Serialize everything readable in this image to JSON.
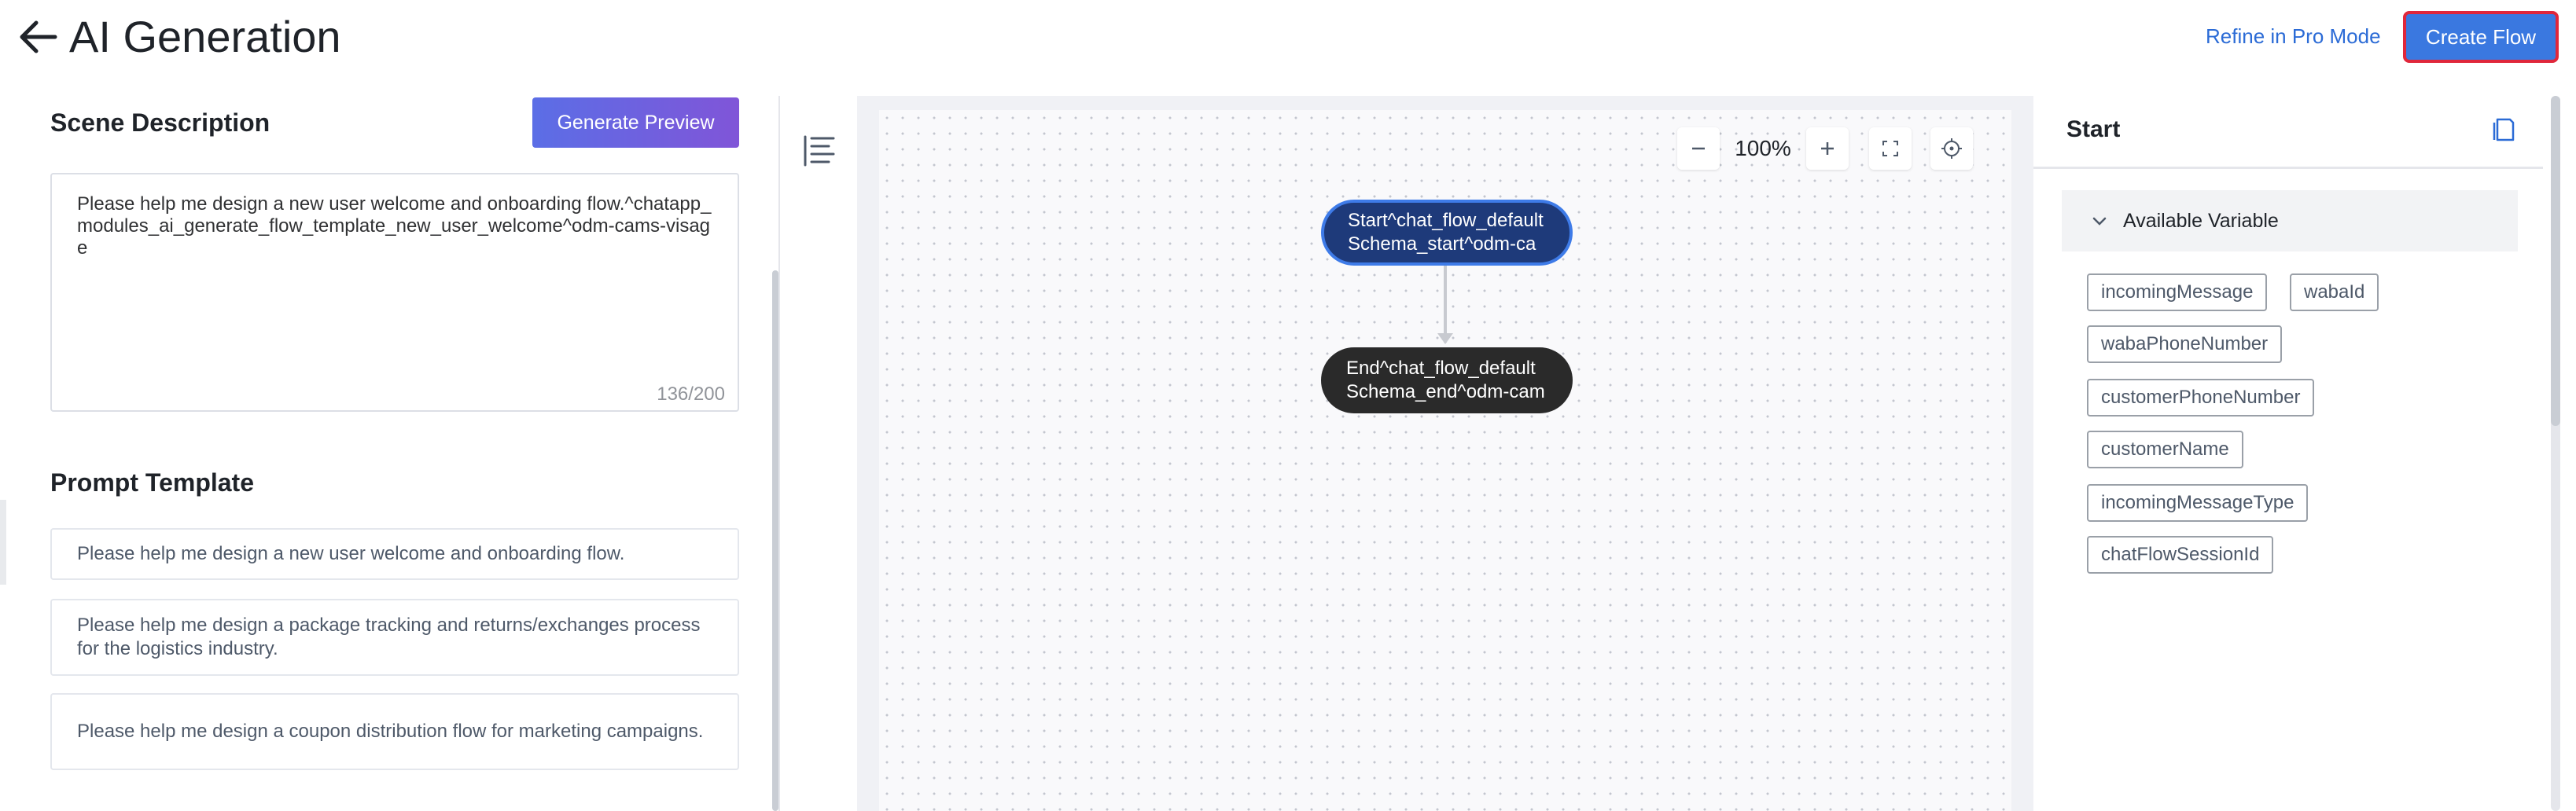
{
  "header": {
    "title": "AI Generation",
    "refine_label": "Refine in Pro Mode",
    "create_label": "Create Flow"
  },
  "scene": {
    "title": "Scene Description",
    "generate_label": "Generate Preview",
    "description": "Please help me design a new user welcome and onboarding flow.^chatapp_modules_ai_generate_flow_template_new_user_welcome^odm-cams-visage",
    "counter": "136/200"
  },
  "prompt": {
    "title": "Prompt Template",
    "items": [
      "Please help me design a new user welcome and onboarding flow.",
      "Please help me design a package tracking and returns/exchanges process for the logistics industry.",
      "Please help me design a coupon distribution flow for marketing campaigns."
    ]
  },
  "canvas": {
    "zoom": "100%",
    "start_node": "Start^chat_flow_defaultSchema_start^odm-cams-visage",
    "end_node": "End^chat_flow_defaultSchema_end^odm-cams-visage"
  },
  "panel": {
    "title": "Start",
    "variables_title": "Available Variable",
    "variables": [
      "incomingMessage",
      "wabaId",
      "wabaPhoneNumber",
      "customerPhoneNumber",
      "customerName",
      "incomingMessageType",
      "chatFlowSessionId"
    ]
  },
  "colors": {
    "accent": "#3a78e0",
    "link": "#2b6bd6",
    "highlight_border": "#e0273b",
    "start_node": "#1e3a7a",
    "end_node": "#2a2a2a"
  },
  "icons": {
    "back": "arrow-left-icon",
    "outline": "list-outline-icon",
    "zoom_out": "minus-icon",
    "zoom_in": "plus-icon",
    "fit": "fullscreen-icon",
    "locate": "crosshair-icon",
    "doc": "document-icon",
    "collapse": "chevron-down-icon"
  }
}
